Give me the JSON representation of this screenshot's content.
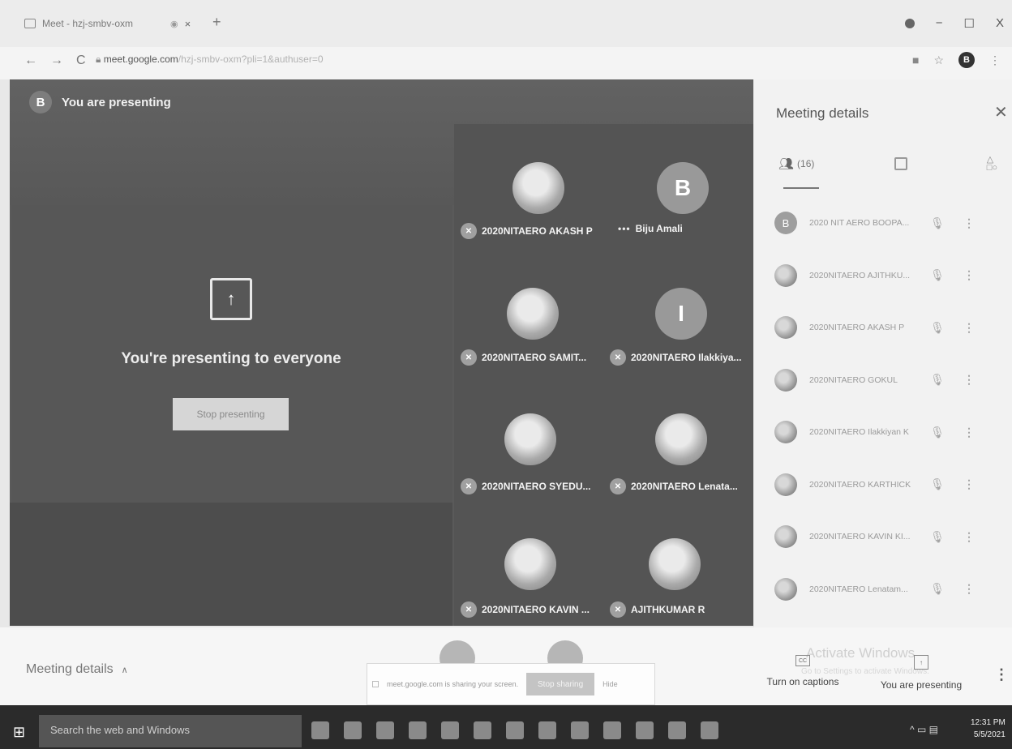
{
  "browser": {
    "tab_title": "Meet - hzj-smbv-oxm",
    "new_tab": "+",
    "url_domain": "meet.google.com",
    "url_rest": "/hzj-smbv-oxm?pli=1&authuser=0",
    "profile_initial": "B",
    "window_controls": [
      "−",
      "☐",
      "X"
    ]
  },
  "stage": {
    "presenter_initial": "B",
    "presenter_label": "You are presenting",
    "present_message": "You're presenting to everyone",
    "stop_presenting_label": "Stop presenting"
  },
  "tiles": [
    {
      "name": "2020NITAERO AKASH P",
      "avatar": "photo",
      "mic": "off"
    },
    {
      "name": "Biju Amali",
      "avatar": "letter",
      "initial": "B",
      "mic": "speaking"
    },
    {
      "name": "2020NITAERO SAMIT...",
      "avatar": "photo",
      "mic": "off"
    },
    {
      "name": "2020NITAERO Ilakkiya...",
      "avatar": "letter",
      "initial": "I",
      "mic": "off"
    },
    {
      "name": "2020NITAERO SYEDU...",
      "avatar": "photo",
      "mic": "off"
    },
    {
      "name": "2020NITAERO Lenata...",
      "avatar": "photo",
      "mic": "off"
    },
    {
      "name": "2020NITAERO KAVIN ...",
      "avatar": "photo",
      "mic": "off"
    },
    {
      "name": "AJITHKUMAR R",
      "avatar": "photo",
      "mic": "off"
    }
  ],
  "side_panel": {
    "title": "Meeting details",
    "people_count": "(16)",
    "participants": [
      {
        "name": "2020 NIT AERO BOOPA...",
        "avatar": "letter",
        "initial": "B"
      },
      {
        "name": "2020NITAERO AJITHKU...",
        "avatar": "photo"
      },
      {
        "name": "2020NITAERO AKASH P",
        "avatar": "photo"
      },
      {
        "name": "2020NITAERO GOKUL",
        "avatar": "photo"
      },
      {
        "name": "2020NITAERO Ilakkiyan K",
        "avatar": "photo"
      },
      {
        "name": "2020NITAERO KARTHICK",
        "avatar": "photo"
      },
      {
        "name": "2020NITAERO KAVIN KI...",
        "avatar": "photo"
      },
      {
        "name": "2020NITAERO Lenatam...",
        "avatar": "photo"
      }
    ]
  },
  "bottom": {
    "meeting_details": "Meeting details",
    "share_notice": "meet.google.com is sharing your screen.",
    "stop_sharing": "Stop sharing",
    "hide": "Hide",
    "watermark": "Activate Windows",
    "watermark_sub": "Go to Settings to activate Windows.",
    "captions_label": "Turn on captions",
    "present_label": "You are presenting"
  },
  "taskbar": {
    "search": "Search the web and Windows",
    "time": "12:31 PM",
    "date": "5/5/2021"
  }
}
